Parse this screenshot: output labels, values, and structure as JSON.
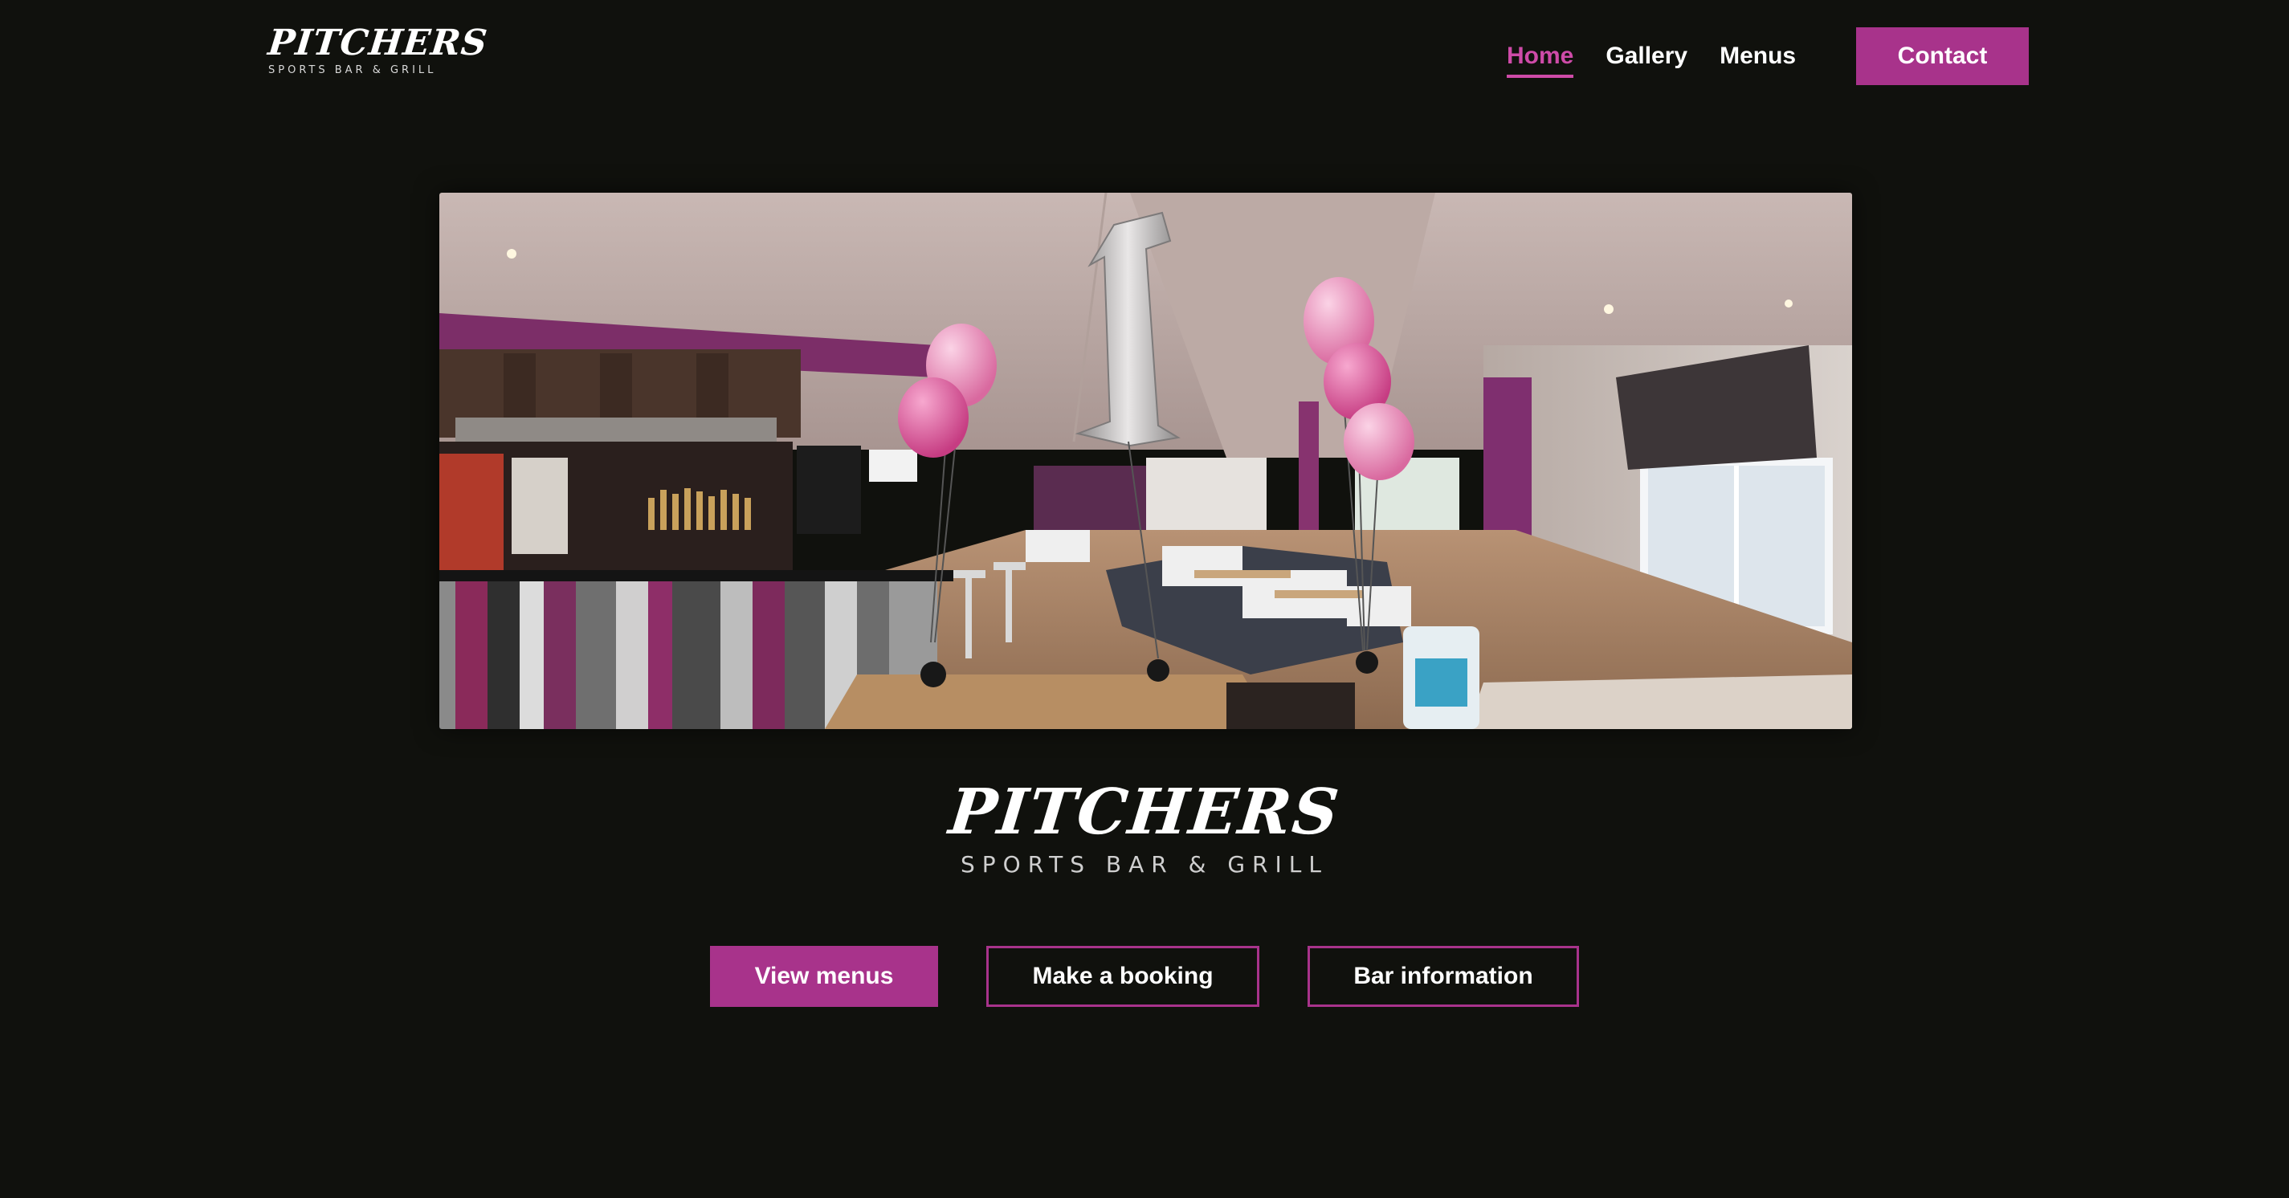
{
  "brand": {
    "logo_name": "PITCHERS",
    "logo_tagline": "SPORTS BAR & GRILL",
    "hero_name": "PITCHERS",
    "hero_tagline": "SPORTS BAR & GRILL"
  },
  "nav": {
    "items": [
      {
        "label": "Home",
        "active": true
      },
      {
        "label": "Gallery",
        "active": false
      },
      {
        "label": "Menus",
        "active": false
      }
    ],
    "contact_label": "Contact"
  },
  "hero_image": {
    "description_icon": "bar-interior-photo"
  },
  "actions": {
    "view_menus": "View menus",
    "make_booking": "Make a booking",
    "bar_information": "Bar information"
  },
  "colors": {
    "background": "#10110d",
    "accent": "#a8338b",
    "accent_light": "#ce4ba8"
  }
}
